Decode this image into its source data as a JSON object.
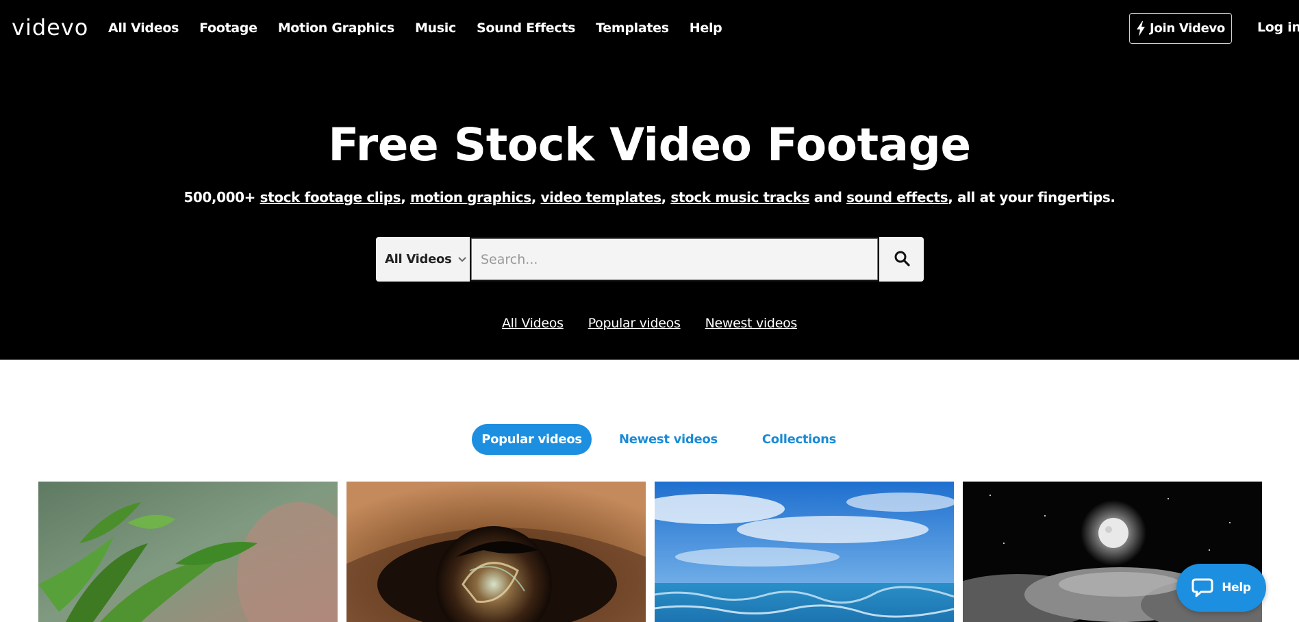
{
  "header": {
    "logo": "videvo",
    "nav": [
      "All Videos",
      "Footage",
      "Motion Graphics",
      "Music",
      "Sound Effects",
      "Templates",
      "Help"
    ],
    "join_label": "Join Videvo",
    "login_label": "Log in"
  },
  "hero": {
    "title": "Free Stock Video Footage",
    "subtitle": {
      "prefix": "500,000+ ",
      "link1": "stock footage clips",
      "sep1": ", ",
      "link2": "motion graphics",
      "sep2": ", ",
      "link3": "video templates",
      "sep3": ", ",
      "link4": "stock music tracks",
      "mid": " and ",
      "link5": "sound effects",
      "suffix": ", all at your fingertips."
    },
    "search": {
      "category": "All Videos",
      "placeholder": "Search..."
    },
    "quick_links": [
      "All Videos",
      "Popular videos",
      "Newest videos"
    ]
  },
  "tabs": [
    "Popular videos",
    "Newest videos",
    "Collections"
  ],
  "active_tab": "Popular videos",
  "thumbnails": [
    "rain-leaves",
    "eye-abstract",
    "ocean-sky",
    "moon-clouds"
  ],
  "help_widget": {
    "label": "Help"
  },
  "colors": {
    "accent": "#1d8fe0",
    "link": "#1a8bd6",
    "hero_bg": "#000000"
  }
}
